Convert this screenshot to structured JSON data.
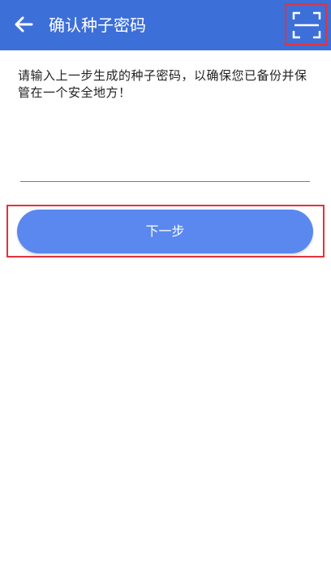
{
  "header": {
    "title": "确认种子密码",
    "back_icon": "arrow-left-icon",
    "scan_icon": "scan-icon",
    "background_color": "#3d6fd8"
  },
  "instruction": "请输入上一步生成的种子密码，以确保您已备份并保管在一个安全地方！",
  "seed_input": {
    "value": "",
    "placeholder": ""
  },
  "next_button": {
    "label": "下一步",
    "color": "#5a88ef"
  },
  "highlight_color": "#e2333b"
}
